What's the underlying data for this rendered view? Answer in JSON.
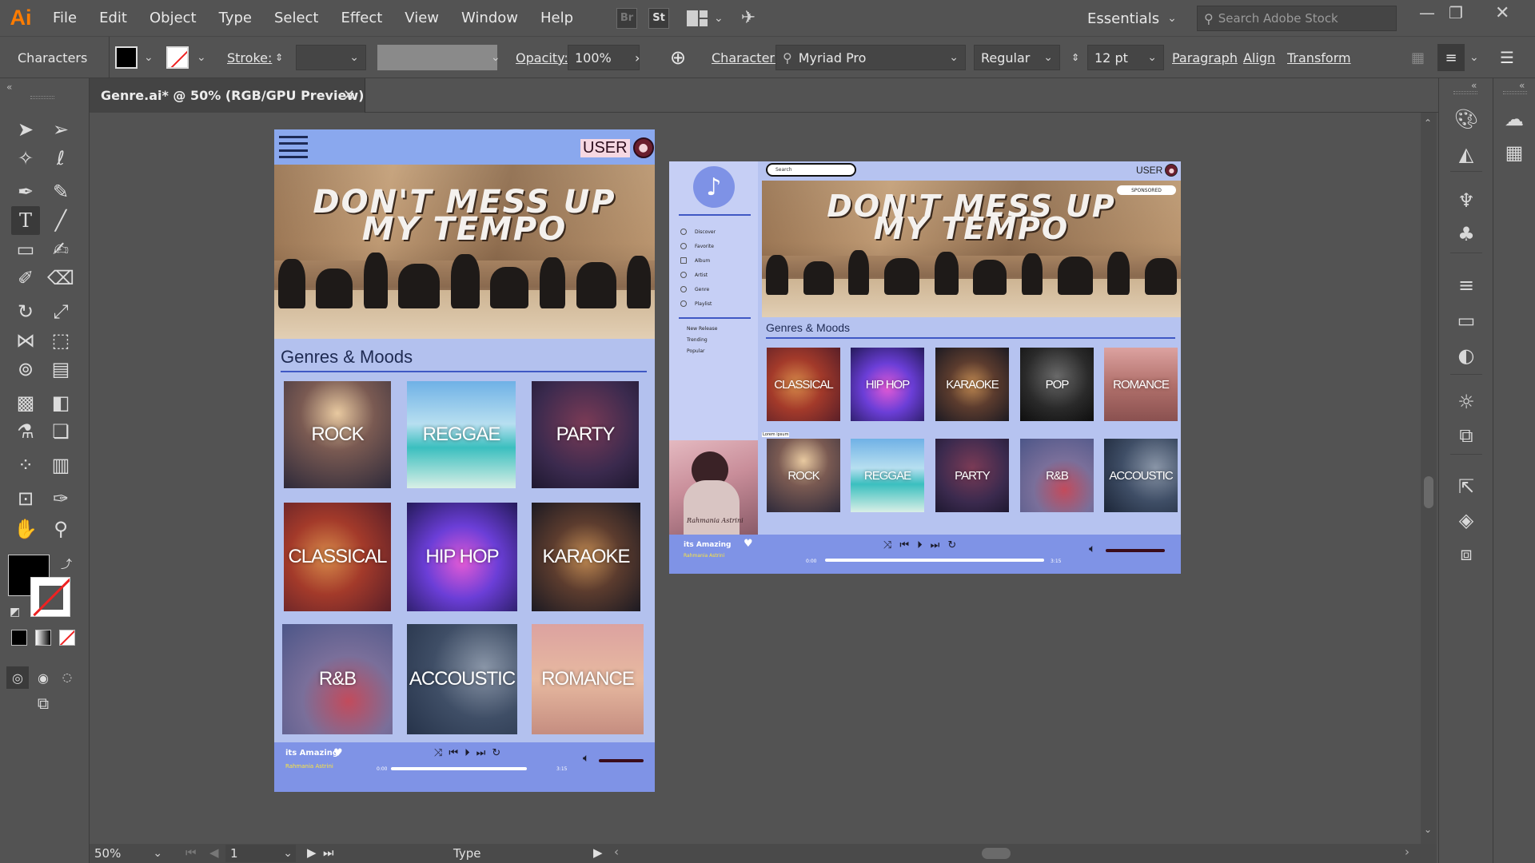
{
  "app": {
    "logo": "Ai",
    "menu": [
      "File",
      "Edit",
      "Object",
      "Type",
      "Select",
      "Effect",
      "View",
      "Window",
      "Help"
    ],
    "bridge_label": "Br",
    "stock_label": "St",
    "workspace": "Essentials",
    "search_placeholder": "Search Adobe Stock"
  },
  "control_bar": {
    "panel_name": "Characters",
    "stroke_label": "Stroke:",
    "opacity_label": "Opacity:",
    "opacity_value": "100%",
    "character_label": "Character:",
    "font_family": "Myriad Pro",
    "font_style": "Regular",
    "font_size": "12 pt",
    "paragraph_label": "Paragraph",
    "align_label": "Align",
    "transform_label": "Transform"
  },
  "document": {
    "tab_title": "Genre.ai* @ 50% (RGB/GPU Preview)",
    "close_glyph": "✕"
  },
  "status_bar": {
    "zoom": "50%",
    "artboard_number": "1",
    "tool_name": "Type"
  },
  "mobile_artboard": {
    "user_label": "USER",
    "banner_line1": "DON'T MESS UP",
    "banner_line2": "MY TEMPO",
    "section_title": "Genres & Moods",
    "genres": [
      "ROCK",
      "REGGAE",
      "PARTY",
      "CLASSICAL",
      "HIP HOP",
      "KARAOKE",
      "R&B",
      "ACCOUSTIC",
      "ROMANCE"
    ],
    "player": {
      "song": "its Amazing",
      "artist": "Rahmania Astrini",
      "time_start": "0:00",
      "time_end": "3:15",
      "progress": 0.0
    }
  },
  "desktop_artboard": {
    "search_placeholder": "Search",
    "user_label": "USER",
    "sponsored_label": "SPONSORED",
    "banner_line1": "DON'T MESS UP",
    "banner_line2": "MY TEMPO",
    "nav_items": [
      "Discover",
      "Favorite",
      "Album",
      "Artist",
      "Genre",
      "Playlist"
    ],
    "sub_items": [
      "New Release",
      "Trending",
      "Popular"
    ],
    "section_title": "Genres & Moods",
    "tiny_label": "Lorem ipsum",
    "genres_row1": [
      "CLASSICAL",
      "HIP HOP",
      "KARAOKE",
      "POP",
      "ROMANCE"
    ],
    "genres_row2": [
      "ROCK",
      "REGGAE",
      "PARTY",
      "R&B",
      "ACCOUSTIC"
    ],
    "album_signature": "Rahmania Astrini",
    "player": {
      "song": "its Amazing",
      "artist": "Rahmania Astrini",
      "time_start": "0:00",
      "time_end": "3:15",
      "progress": 0.0
    }
  }
}
